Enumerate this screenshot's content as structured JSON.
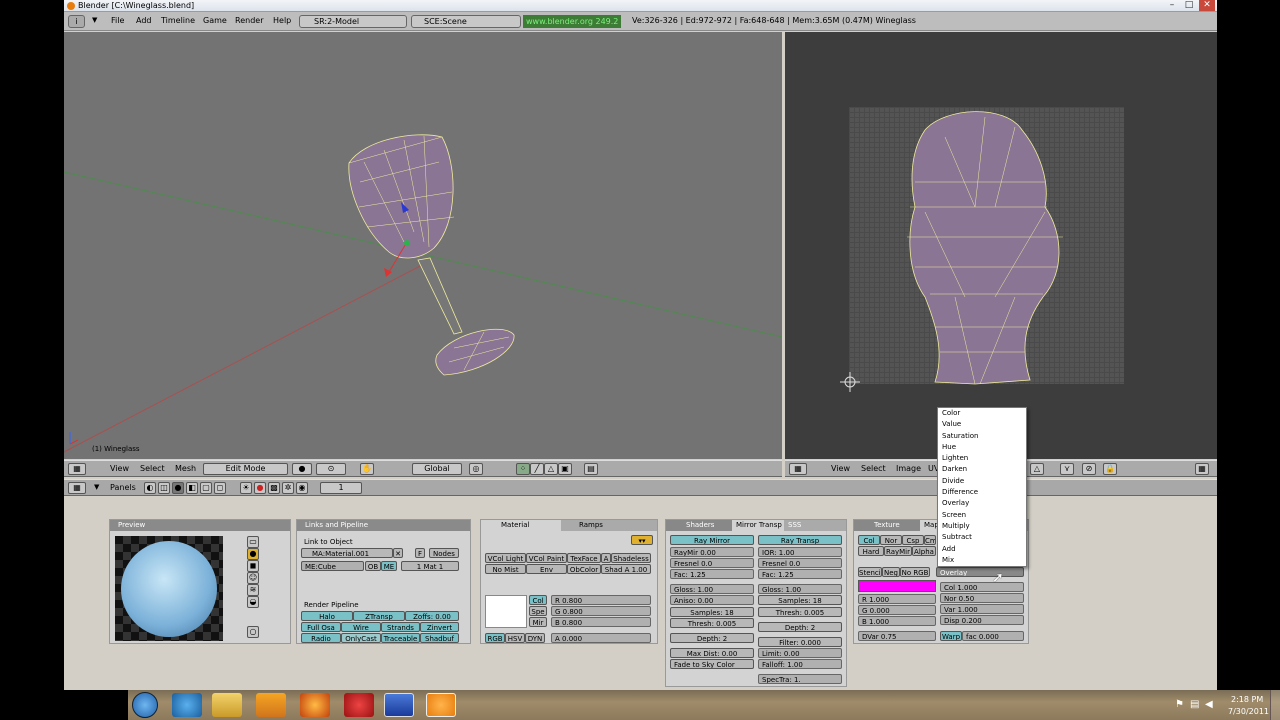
{
  "window": {
    "title": "Blender [C:\\Wineglass.blend]",
    "minimize": "–",
    "maximize": "□",
    "close": "✕"
  },
  "menubar": {
    "menus": [
      "File",
      "Add",
      "Timeline",
      "Game",
      "Render",
      "Help"
    ],
    "screen_field": "SR:2-Model",
    "scene_field": "SCE:Scene",
    "url": "www.blender.org 249.2",
    "stats": "Ve:326-326 | Ed:972-972 | Fa:648-648 | Mem:3.65M (0.47M) Wineglass"
  },
  "viewport": {
    "object_label": "(1) Wineglass"
  },
  "view3d_header": {
    "menus": [
      "View",
      "Select",
      "Mesh"
    ],
    "mode": "Edit Mode",
    "orientation": "Global"
  },
  "uv_header": {
    "menus": [
      "View",
      "Select",
      "Image",
      "UVs"
    ]
  },
  "buttons_header": {
    "panels_label": "Panels",
    "frame": "1"
  },
  "preview_panel": {
    "title": "Preview"
  },
  "links_panel": {
    "title": "Links and Pipeline",
    "link_to_object": "Link to Object",
    "material_field": "MA:Material.001",
    "f_label": "F",
    "nodes_button": "Nodes",
    "mesh_field": "ME:Cube",
    "ob_button": "OB",
    "me_button": "ME",
    "mat_counter": "1 Mat 1",
    "render_pipeline": "Render Pipeline",
    "buttons": [
      "Halo",
      "ZTransp",
      "Zoffs: 0.00",
      "Full Osa",
      "Wire",
      "Strands",
      "Zinvert",
      "Radio",
      "OnlyCast",
      "Traceable",
      "Shadbuf"
    ]
  },
  "material_panel": {
    "tabs": [
      "Material",
      "Ramps"
    ],
    "row1": [
      "VCol Light",
      "VCol Paint",
      "TexFace",
      "A",
      "Shadeless"
    ],
    "row2": [
      "No Mist",
      "Env",
      "ObColor",
      "Shad A 1.00"
    ],
    "color_buttons": [
      "Col",
      "Spe",
      "Mir"
    ],
    "rgb": [
      "R 0.800",
      "G 0.800",
      "B 0.800"
    ],
    "modes": [
      "RGB",
      "HSV",
      "DYN"
    ],
    "alpha": "A 0.000"
  },
  "shaders_panel": {
    "tabs": [
      "Shaders",
      "Mirror Transp",
      "SSS"
    ],
    "ray_mirror": "Ray Mirror",
    "ray_transp": "Ray Transp",
    "left": [
      "RayMir 0.00",
      "Fresnel 0.0",
      "Fac: 1.25",
      "Gloss: 1.00",
      "Aniso: 0.00",
      "Samples: 18",
      "Thresh: 0.005",
      "Depth: 2",
      "Max Dist: 0.00",
      "Fade to Sky Color"
    ],
    "right": [
      "IOR: 1.00",
      "Fresnel 0.0",
      "Fac: 1.25",
      "Gloss: 1.00",
      "Samples: 18",
      "Thresh: 0.005",
      "Depth: 2",
      "Filter: 0.000",
      "Limit: 0.00",
      "Falloff: 1.00",
      "SpecTra: 1."
    ]
  },
  "texture_panel": {
    "tabs": [
      "Texture",
      "Map"
    ],
    "row1": [
      "Col",
      "Nor",
      "Csp",
      "Cm"
    ],
    "row2": [
      "Hard",
      "RayMir",
      "Alpha"
    ],
    "row3": [
      "Stencil",
      "Neg",
      "No RGB"
    ],
    "blend_selected": "Overlay",
    "values": [
      "R 1.000",
      "G 0.000",
      "B 1.000",
      "DVar 0.75",
      "Col 1.000",
      "Nor 0.50",
      "Var 1.000",
      "Disp 0.200",
      "Warp",
      "fac 0.000"
    ],
    "swatch_color": "#ff00ff"
  },
  "blend_dropdown": {
    "items": [
      "Color",
      "Value",
      "Saturation",
      "Hue",
      "Lighten",
      "Darken",
      "Divide",
      "Difference",
      "Overlay",
      "Screen",
      "Multiply",
      "Subtract",
      "Add",
      "Mix"
    ]
  },
  "taskbar": {
    "time": "2:18 PM",
    "date": "7/30/2011"
  }
}
